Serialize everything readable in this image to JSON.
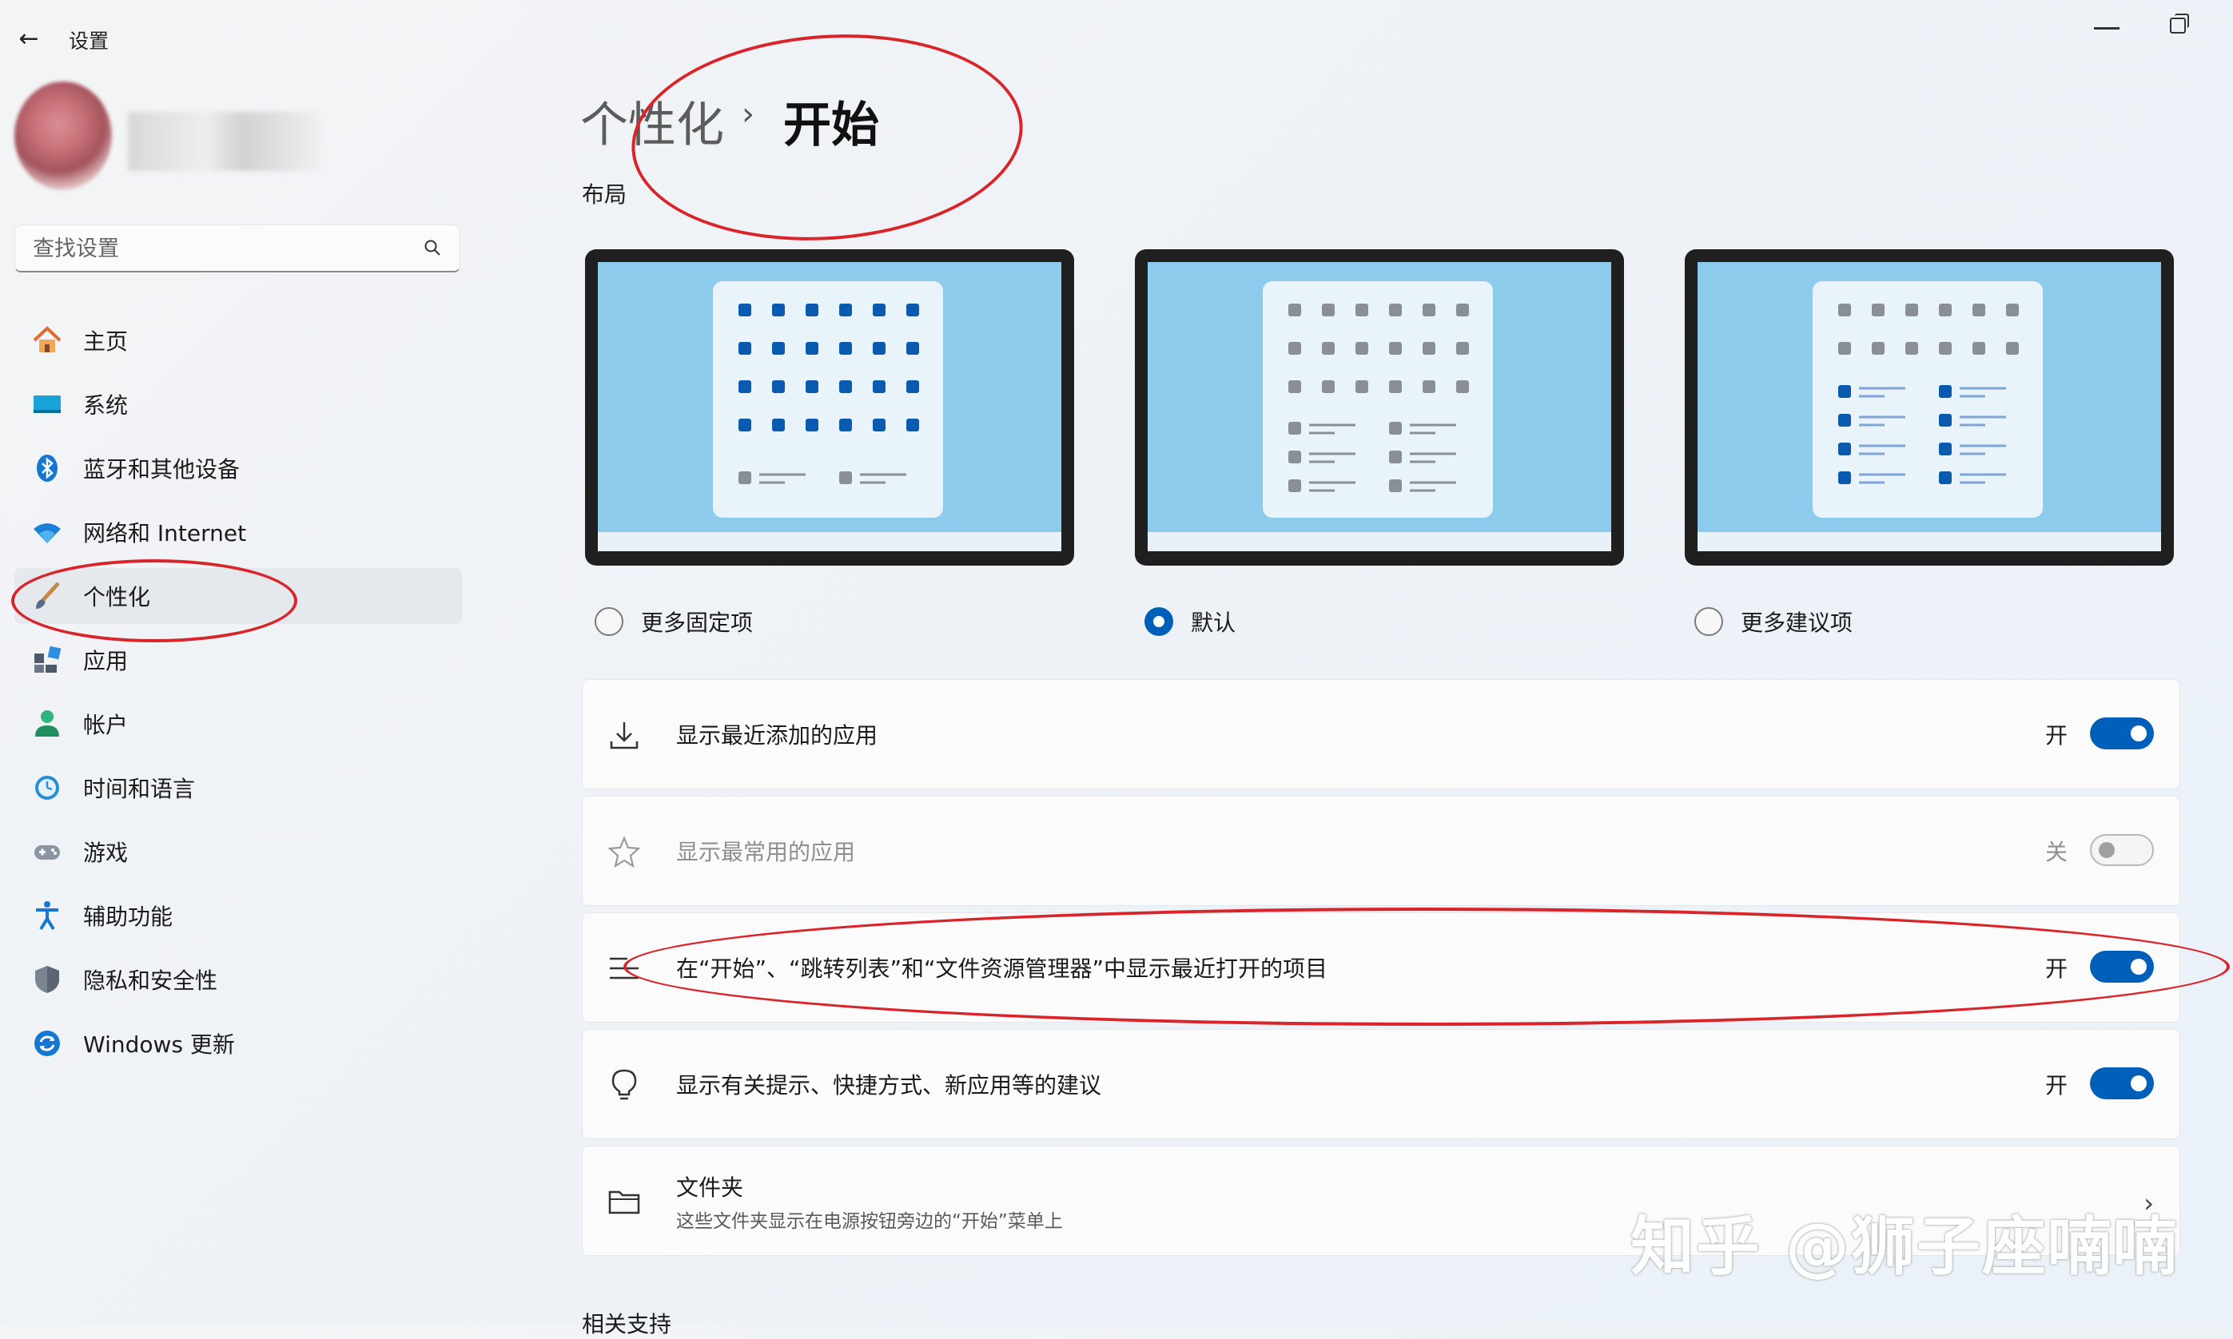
{
  "window": {
    "title": "设置",
    "back_icon": "back-arrow-icon",
    "minimize_icon": "minimize-icon",
    "restore_icon": "restore-icon"
  },
  "search": {
    "placeholder": "查找设置",
    "icon": "search-icon"
  },
  "sidebar": {
    "items": [
      {
        "label": "主页",
        "icon": "home-icon",
        "active": false
      },
      {
        "label": "系统",
        "icon": "system-display-icon",
        "active": false
      },
      {
        "label": "蓝牙和其他设备",
        "icon": "bluetooth-icon",
        "active": false
      },
      {
        "label": "网络和 Internet",
        "icon": "wifi-icon",
        "active": false
      },
      {
        "label": "个性化",
        "icon": "paintbrush-icon",
        "active": true
      },
      {
        "label": "应用",
        "icon": "apps-icon",
        "active": false
      },
      {
        "label": "帐户",
        "icon": "account-icon",
        "active": false
      },
      {
        "label": "时间和语言",
        "icon": "time-language-icon",
        "active": false
      },
      {
        "label": "游戏",
        "icon": "gamepad-icon",
        "active": false
      },
      {
        "label": "辅助功能",
        "icon": "accessibility-icon",
        "active": false
      },
      {
        "label": "隐私和安全性",
        "icon": "shield-icon",
        "active": false
      },
      {
        "label": "Windows 更新",
        "icon": "windows-update-icon",
        "active": false
      }
    ]
  },
  "breadcrumb": {
    "parent": "个性化",
    "separator": "›",
    "current": "开始"
  },
  "layout_section": {
    "label": "布局",
    "options": [
      {
        "label": "更多固定项",
        "selected": false
      },
      {
        "label": "默认",
        "selected": true
      },
      {
        "label": "更多建议项",
        "selected": false
      }
    ]
  },
  "settings": [
    {
      "label": "显示最近添加的应用",
      "state": "开",
      "on": true,
      "enabled": true,
      "icon": "download-icon"
    },
    {
      "label": "显示最常用的应用",
      "state": "关",
      "on": false,
      "enabled": false,
      "icon": "star-icon"
    },
    {
      "label": "在“开始”、“跳转列表”和“文件资源管理器”中显示最近打开的项目",
      "state": "开",
      "on": true,
      "enabled": true,
      "icon": "list-icon"
    },
    {
      "label": "显示有关提示、快捷方式、新应用等的建议",
      "state": "开",
      "on": true,
      "enabled": true,
      "icon": "lightbulb-icon"
    }
  ],
  "folders": {
    "title": "文件夹",
    "subtitle": "这些文件夹显示在电源按钮旁边的“开始”菜单上",
    "icon": "folder-icon"
  },
  "related": {
    "label": "相关支持"
  },
  "watermark": "知乎 @狮子座喃喃",
  "colors": {
    "accent": "#005fb8",
    "annotation": "#d9242a",
    "preview_bg": "#8ccbec"
  }
}
